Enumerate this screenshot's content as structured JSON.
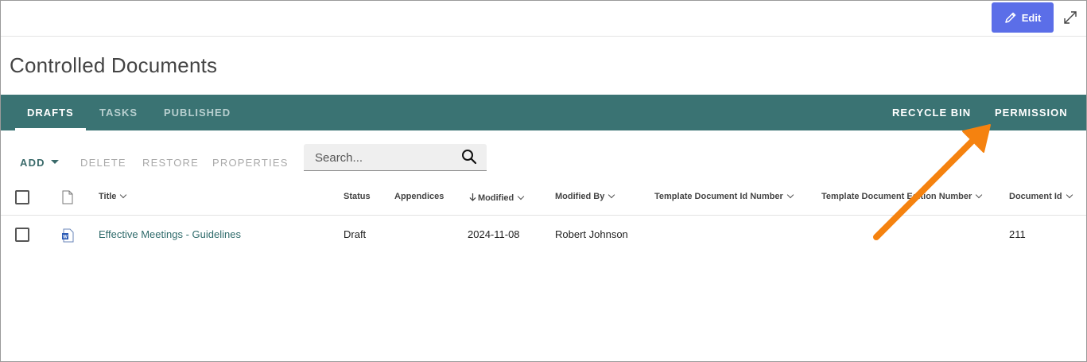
{
  "header": {
    "edit_label": "Edit"
  },
  "page_title": "Controlled Documents",
  "tabs": [
    {
      "label": "DRAFTS"
    },
    {
      "label": "TASKS"
    },
    {
      "label": "PUBLISHED"
    }
  ],
  "right_tabs": [
    {
      "label": "RECYCLE BIN"
    },
    {
      "label": "PERMISSION"
    }
  ],
  "toolbar": {
    "add": "ADD",
    "delete": "DELETE",
    "restore": "RESTORE",
    "properties": "PROPERTIES"
  },
  "search": {
    "placeholder": "Search..."
  },
  "columns": {
    "title": "Title",
    "status": "Status",
    "appendices": "Appendices",
    "modified": "Modified",
    "modified_by": "Modified By",
    "template_id": "Template Document Id Number",
    "template_edition": "Template Document Edition Number",
    "document_id": "Document Id"
  },
  "rows": [
    {
      "title": "Effective Meetings - Guidelines",
      "status": "Draft",
      "appendices": "",
      "modified": "2024-11-08",
      "modified_by": "Robert Johnson",
      "template_id": "",
      "template_edition": "",
      "document_id": "211"
    }
  ],
  "colors": {
    "nav": "#3a7373",
    "edit_button": "#5b6ee8",
    "annotation_arrow": "#f5820f",
    "link": "#2f6b6b"
  },
  "icons": [
    "pencil-icon",
    "expand-icon",
    "search-icon",
    "caret-down-icon",
    "document-icon",
    "word-file-icon",
    "sort-down-arrow-icon"
  ]
}
